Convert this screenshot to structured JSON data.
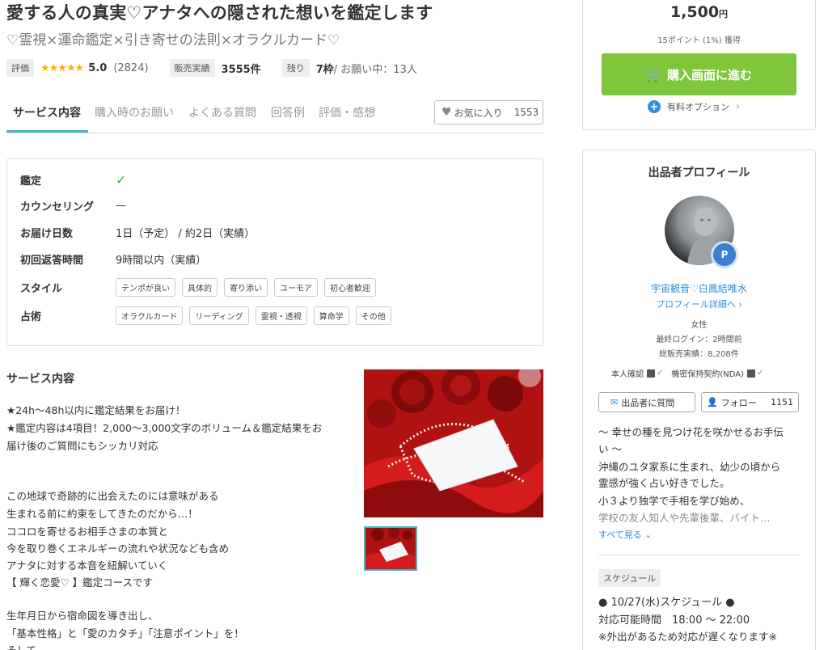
{
  "title": "愛する人の真実♡アナタへの隠された想いを鑑定します",
  "subtitle": "♡霊視×運命鑑定×引き寄せの法則×オラクルカード♡",
  "meta": {
    "rating_label": "評価",
    "stars": "★★★★★",
    "rating": "5.0",
    "rating_count": "(2824)",
    "sales_label": "販売実績",
    "sales": "3555件",
    "remain_label": "残り",
    "remain": "7枠",
    "request": " / お願い中：13人"
  },
  "tabs": [
    {
      "label": "サービス内容"
    },
    {
      "label": "購入時のお願い"
    },
    {
      "label": "よくある質問"
    },
    {
      "label": "回答例"
    },
    {
      "label": "評価・感想"
    }
  ],
  "favorite": {
    "label": "お気に入り",
    "count": "1553"
  },
  "info": {
    "appraisal_label": "鑑定",
    "appraisal_value": "✓",
    "counseling_label": "カウンセリング",
    "counseling_value": "—",
    "delivery_label": "お届け日数",
    "delivery_value": "1日（予定） / 約2日（実績）",
    "first_reply_label": "初回返答時間",
    "first_reply_value": "9時間以内（実績）",
    "style_label": "スタイル",
    "styles": [
      "テンポが良い",
      "具体的",
      "寄り添い",
      "ユーモア",
      "初心者歓迎"
    ],
    "divination_label": "占術",
    "divinations": [
      "オラクルカード",
      "リーディング",
      "霊視・透視",
      "算命学",
      "その他"
    ]
  },
  "service": {
    "heading": "サービス内容",
    "lines": [
      "★24h～48h以内に鑑定結果をお届け！",
      "★鑑定内容は4項目！2,000～3,000文字のボリューム＆鑑定結果をお",
      "届け後のご質問にもシッカリ対応",
      "この地球で奇跡的に出会えたのには意味がある",
      "生まれる前に約束をしてきたのだから…！",
      "ココロを寄せるお相手さまの本質と",
      "今を取り巻くエネルギーの流れや状況なども含め",
      "アナタに対する本音を紐解いていく",
      "【 輝く恋愛♡ 】鑑定コースです",
      "生年月日から宿命図を導き出し、",
      "「基本性格」と「愛のカタチ」「注意ポイント」を！",
      "そして"
    ]
  },
  "purchase": {
    "price": "1,500",
    "currency": "円",
    "points": "15ポイント (1%) 獲得",
    "buy_label": "購入画面に進む",
    "option_label": "有料オプション"
  },
  "profile": {
    "heading": "出品者プロフィール",
    "name": "宇宙観音♡白鳳結唯水",
    "detail_link": "プロフィール詳細へ",
    "gender": "女性",
    "last_login": "最終ログイン：2時間前",
    "total_sales": "総販売実績：8,208件",
    "identity_label": "本人確認",
    "nda_label": "機密保持契約(NDA)",
    "question_label": "出品者に質問",
    "follow_label": "フォロー",
    "follow_count": "1151",
    "intro": [
      "～ 幸せの種を見つけ花を咲かせるお手伝",
      "い ～",
      "沖縄のユタ家系に生まれ、幼少の頃から",
      "霊感が強く占い好きでした。",
      "小３より独学で手相を学び始め、",
      "学校の友人知人や先輩後輩、バイト…"
    ],
    "see_all": "すべて見る",
    "schedule_label": "スケジュール",
    "schedule_lines": [
      "● 10/27(水)スケジュール ●",
      "対応可能時間　18:00 ～ 22:00",
      "※外出があるため対応が遅くなります※"
    ]
  }
}
